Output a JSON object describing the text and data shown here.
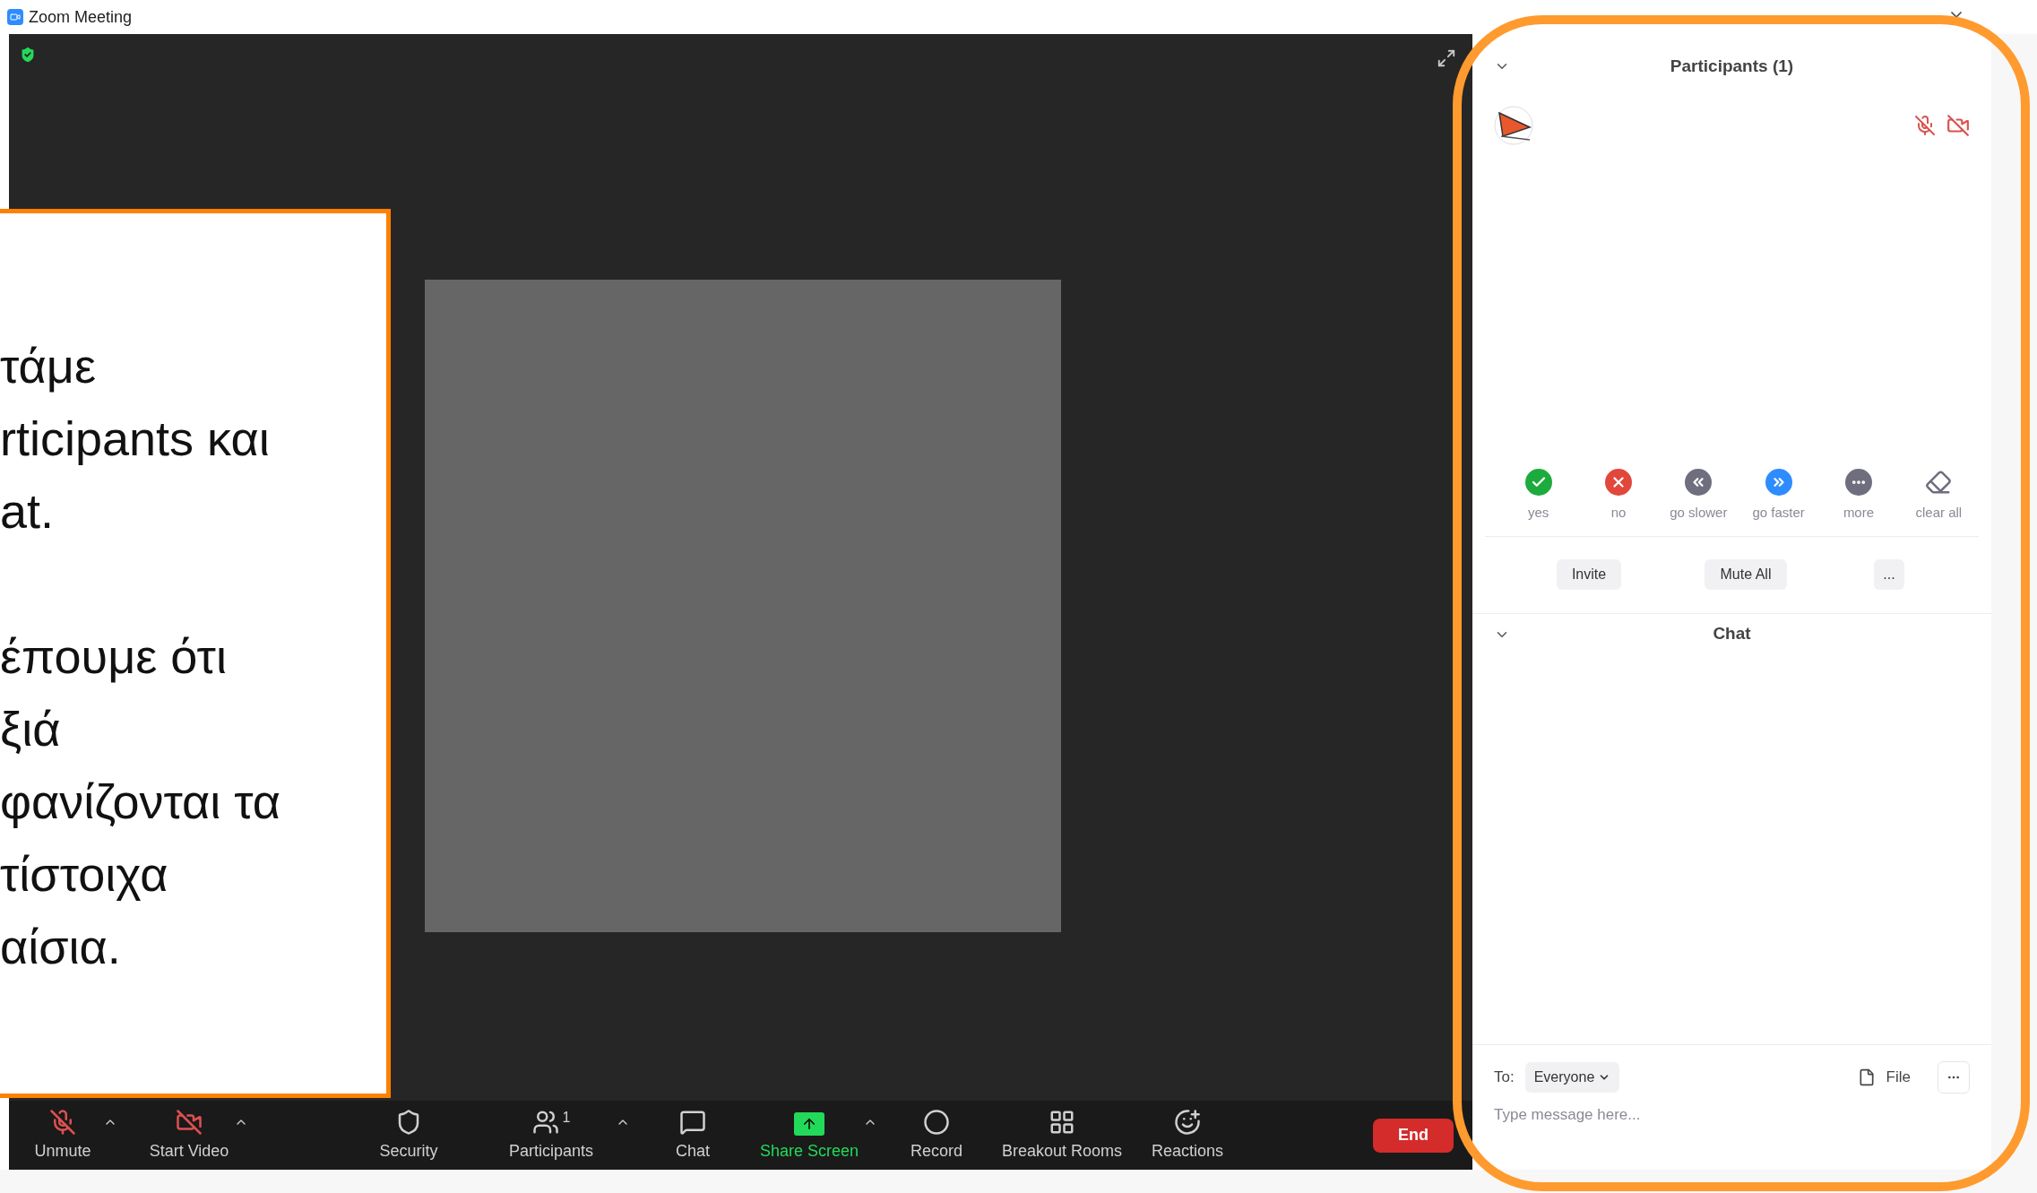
{
  "window": {
    "title": "Zoom Meeting"
  },
  "callout": {
    "paragraphs": [
      [
        "τάμε",
        "rticipants και",
        "at."
      ],
      [
        "έπουμε ότι",
        "ξιά",
        "φανίζονται τα",
        "τίστοιχα",
        "αίσια."
      ]
    ]
  },
  "toolbar": {
    "items": [
      {
        "label": "Unmute",
        "kind": "mic_off",
        "has_menu": true,
        "accent": false
      },
      {
        "label": "Start Video",
        "kind": "video_off",
        "has_menu": true,
        "accent": false
      },
      {
        "label": "Security",
        "kind": "security",
        "has_menu": false,
        "accent": false
      },
      {
        "label": "Participants",
        "kind": "participants",
        "count": "1",
        "has_menu": true,
        "accent": false
      },
      {
        "label": "Chat",
        "kind": "chat",
        "has_menu": false,
        "accent": false
      },
      {
        "label": "Share Screen",
        "kind": "share",
        "has_menu": true,
        "accent": true
      },
      {
        "label": "Record",
        "kind": "record",
        "has_menu": false,
        "accent": false
      },
      {
        "label": "Breakout Rooms",
        "kind": "breakout",
        "has_menu": false,
        "accent": false
      },
      {
        "label": "Reactions",
        "kind": "reactions",
        "has_menu": false,
        "accent": false
      }
    ],
    "end": "End"
  },
  "participants_panel": {
    "title": "Participants (1)",
    "participants": [
      {
        "muted": true,
        "video_off": true
      }
    ],
    "reactions": [
      {
        "label": "yes",
        "kind": "yes"
      },
      {
        "label": "no",
        "kind": "no"
      },
      {
        "label": "go slower",
        "kind": "slower"
      },
      {
        "label": "go faster",
        "kind": "faster"
      },
      {
        "label": "more",
        "kind": "more"
      },
      {
        "label": "clear all",
        "kind": "clear"
      }
    ],
    "buttons": [
      "Invite",
      "Mute All",
      "..."
    ]
  },
  "chat": {
    "title": "Chat",
    "to_label": "To:",
    "recipient": "Everyone",
    "file_label": "File",
    "placeholder": "Type message here..."
  }
}
